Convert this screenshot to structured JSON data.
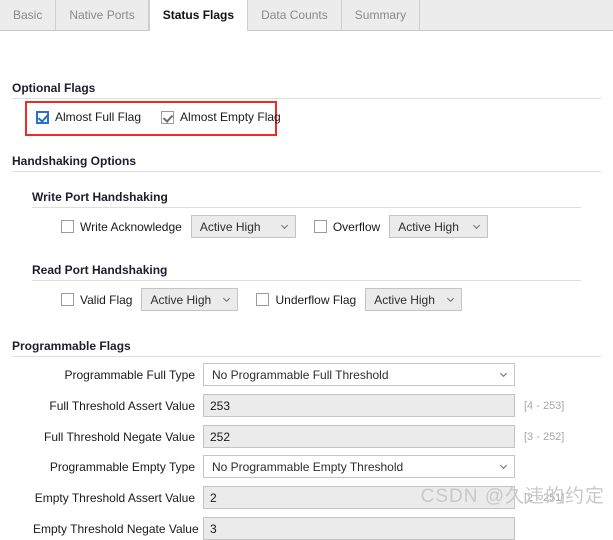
{
  "tabs": [
    {
      "label": "Basic",
      "active": false
    },
    {
      "label": "Native Ports",
      "active": false
    },
    {
      "label": "Status Flags",
      "active": true
    },
    {
      "label": "Data Counts",
      "active": false
    },
    {
      "label": "Summary",
      "active": false
    }
  ],
  "sections": {
    "optional_flags": {
      "title": "Optional Flags",
      "checkboxes": [
        {
          "label": "Almost Full Flag",
          "checked": true,
          "focused": true
        },
        {
          "label": "Almost Empty Flag",
          "checked": true,
          "focused": false
        }
      ]
    },
    "handshaking": {
      "title": "Handshaking Options",
      "write_port": {
        "title": "Write Port Handshaking",
        "items": [
          {
            "label": "Write Acknowledge",
            "checked": false,
            "select_value": "Active High"
          },
          {
            "label": "Overflow",
            "checked": false,
            "select_value": "Active High"
          }
        ]
      },
      "read_port": {
        "title": "Read Port Handshaking",
        "items": [
          {
            "label": "Valid Flag",
            "checked": false,
            "select_value": "Active High"
          },
          {
            "label": "Underflow Flag",
            "checked": false,
            "select_value": "Active High"
          }
        ]
      }
    },
    "programmable_flags": {
      "title": "Programmable Flags",
      "rows": [
        {
          "label": "Programmable Full Type",
          "type": "select",
          "value": "No Programmable Full Threshold",
          "range": ""
        },
        {
          "label": "Full Threshold Assert Value",
          "type": "text",
          "value": "253",
          "range": "[4 - 253]"
        },
        {
          "label": "Full Threshold Negate Value",
          "type": "text",
          "value": "252",
          "range": "[3 - 252]"
        },
        {
          "label": "Programmable Empty Type",
          "type": "select",
          "value": "No Programmable Empty Threshold",
          "range": ""
        },
        {
          "label": "Empty Threshold Assert Value",
          "type": "text",
          "value": "2",
          "range": "[2 - 251]"
        },
        {
          "label": "Empty Threshold Negate Value",
          "type": "text",
          "value": "3",
          "range": ""
        }
      ]
    }
  },
  "watermark": "CSDN @久违的约定",
  "colors": {
    "accent_red": "#ec2a26",
    "focus_blue": "#2a72c8",
    "tab_bg": "#ececec"
  }
}
